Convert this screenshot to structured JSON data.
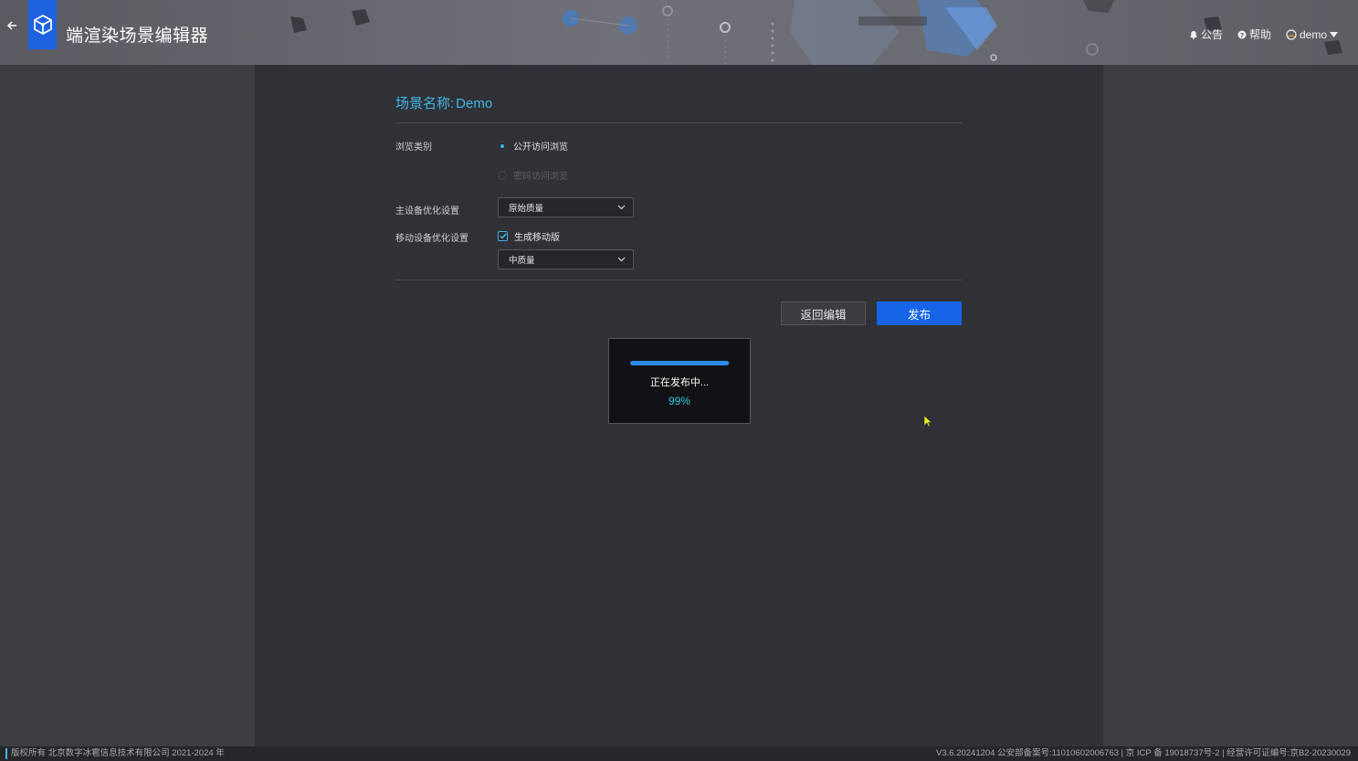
{
  "header": {
    "title": "端渲染场景编辑器",
    "actions": {
      "notice": "公告",
      "help": "帮助",
      "user": "demo"
    },
    "icons": {
      "back": "arrow-left-icon",
      "logo": "cube-logo-icon",
      "notice": "bell-icon",
      "help": "question-icon",
      "user": "avatar-icon"
    }
  },
  "scene": {
    "label": "场景名称:",
    "name": "Demo"
  },
  "form": {
    "browse_label": "浏览类别",
    "browse_options": [
      {
        "label": "公开访问浏览",
        "selected": true,
        "disabled": false
      },
      {
        "label": "密码访问浏览",
        "selected": false,
        "disabled": true
      }
    ],
    "main_device_label": "主设备优化设置",
    "main_device_value": "原始质量",
    "mobile_device_label": "移动设备优化设置",
    "mobile_checkbox_label": "生成移动版",
    "mobile_checkbox_checked": true,
    "mobile_quality_value": "中质量"
  },
  "buttons": {
    "back_to_edit": "返回编辑",
    "publish": "发布"
  },
  "modal": {
    "status_text": "正在发布中...",
    "percent_text": "99%",
    "progress": 0.99
  },
  "footer": {
    "copyright": "版权所有 北京数字冰雹信息技术有限公司 2021-2024 年",
    "version_info": "V3.6.20241204 公安部备案号:11010602006763 | 京 ICP 备 19018737号-2 | 经营许可证编号:京B2-20230029"
  },
  "colors": {
    "accent": "#3fb7e6",
    "primary": "#1664e8",
    "progress": "#2b8cf0",
    "percent": "#2fc9d8"
  }
}
